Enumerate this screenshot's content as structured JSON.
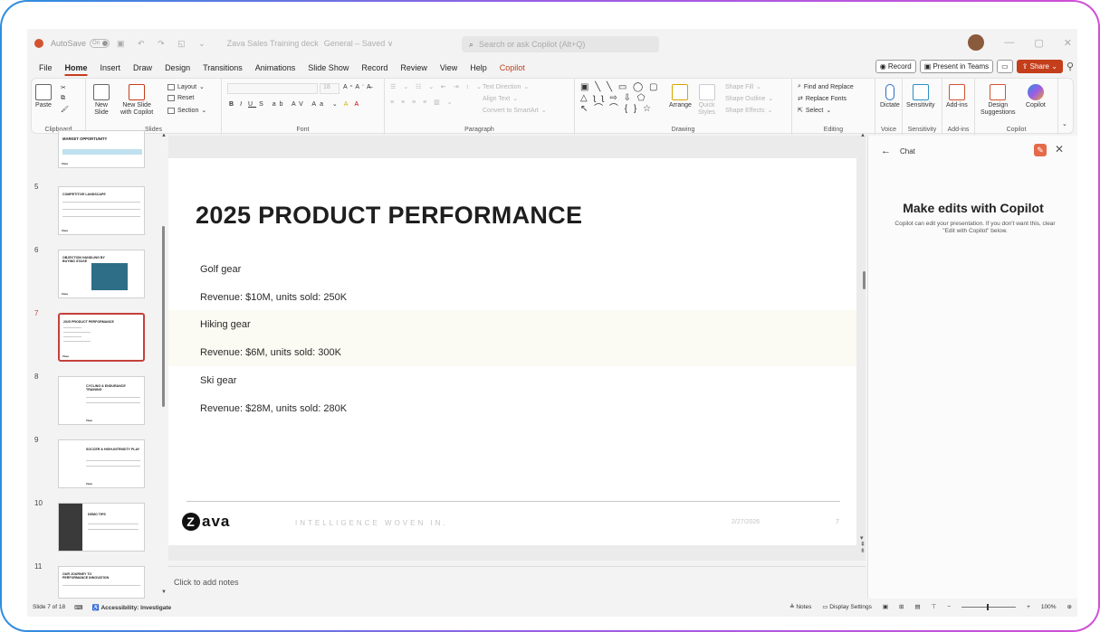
{
  "titlebar": {
    "autosave_label": "AutoSave",
    "autosave_state": "On",
    "document_name": "Zava Sales Training deck",
    "sensitivity": "General – Saved ∨",
    "search_placeholder": "Search or ask Copilot (Alt+Q)"
  },
  "menu_tabs": [
    "File",
    "Home",
    "Insert",
    "Draw",
    "Design",
    "Transitions",
    "Animations",
    "Slide Show",
    "Record",
    "Review",
    "View",
    "Help",
    "Copilot"
  ],
  "menu_right": {
    "record": "Record",
    "present": "Present in Teams",
    "share": "Share"
  },
  "ribbon": {
    "clipboard": {
      "label": "Clipboard",
      "paste": "Paste"
    },
    "slides": {
      "label": "Slides",
      "new_slide": "New\nSlide",
      "new_slide_copilot": "New Slide\nwith Copilot",
      "layout": "Layout",
      "reset": "Reset",
      "section": "Section"
    },
    "font": {
      "label": "Font",
      "size": "18"
    },
    "paragraph": {
      "label": "Paragraph",
      "text_direction": "Text Direction",
      "align_text": "Align Text",
      "convert_smartart": "Convert to SmartArt"
    },
    "drawing": {
      "label": "Drawing",
      "arrange": "Arrange",
      "quick_styles": "Quick\nStyles",
      "shape_fill": "Shape Fill",
      "shape_outline": "Shape Outline",
      "shape_effects": "Shape Effects"
    },
    "editing": {
      "label": "Editing",
      "find_replace": "Find and Replace",
      "replace_fonts": "Replace Fonts",
      "select": "Select"
    },
    "voice": {
      "label": "Voice",
      "dictate": "Dictate"
    },
    "sensitivity": {
      "label": "Sensitivity",
      "btn": "Sensitivity"
    },
    "addins": {
      "label": "Add-ins",
      "btn": "Add-ins"
    },
    "copilot": {
      "label": "Copilot",
      "design": "Design\nSuggestions",
      "copilot": "Copilot"
    }
  },
  "thumbnails": [
    {
      "num": "",
      "title": "MARKET OPPORTUNITY"
    },
    {
      "num": "5",
      "title": "COMPETITIVE LANDSCAPE"
    },
    {
      "num": "6",
      "title": "OBJECTION HANDLING BY BUYING STAGE"
    },
    {
      "num": "7",
      "title": "2025 PRODUCT PERFORMANCE"
    },
    {
      "num": "8",
      "title": "CYCLING & ENDURANCE TRAINING"
    },
    {
      "num": "9",
      "title": "SOCCER & HIGH-INTENSITY PLAY"
    },
    {
      "num": "10",
      "title": "DEMO TIPS"
    },
    {
      "num": "11",
      "title": "OUR JOURNEY TO PERFORMANCE INNOVATION"
    }
  ],
  "slide": {
    "title": "2025 PRODUCT PERFORMANCE",
    "lines": [
      "Golf gear",
      "Revenue: $10M, units sold: 250K",
      "Hiking gear",
      "Revenue: $6M, units sold: 300K",
      "Ski gear",
      "Revenue: $28M, units sold: 280K"
    ],
    "footer_logo": "ava",
    "footer_logo_z": "Z",
    "footer_tagline": "INTELLIGENCE WOVEN IN.",
    "footer_date": "2/27/2026",
    "footer_page": "7"
  },
  "notes_placeholder": "Click to add notes",
  "copilot_pane": {
    "header": "Chat",
    "title": "Make edits with Copilot",
    "description": "Copilot can edit your presentation. If you don't want this, clear \"Edit with Copilot\" below."
  },
  "statusbar": {
    "slide_count": "Slide 7 of 18",
    "accessibility": "Accessibility: Investigate",
    "notes": "Notes",
    "display_settings": "Display Settings",
    "zoom": "100%"
  }
}
